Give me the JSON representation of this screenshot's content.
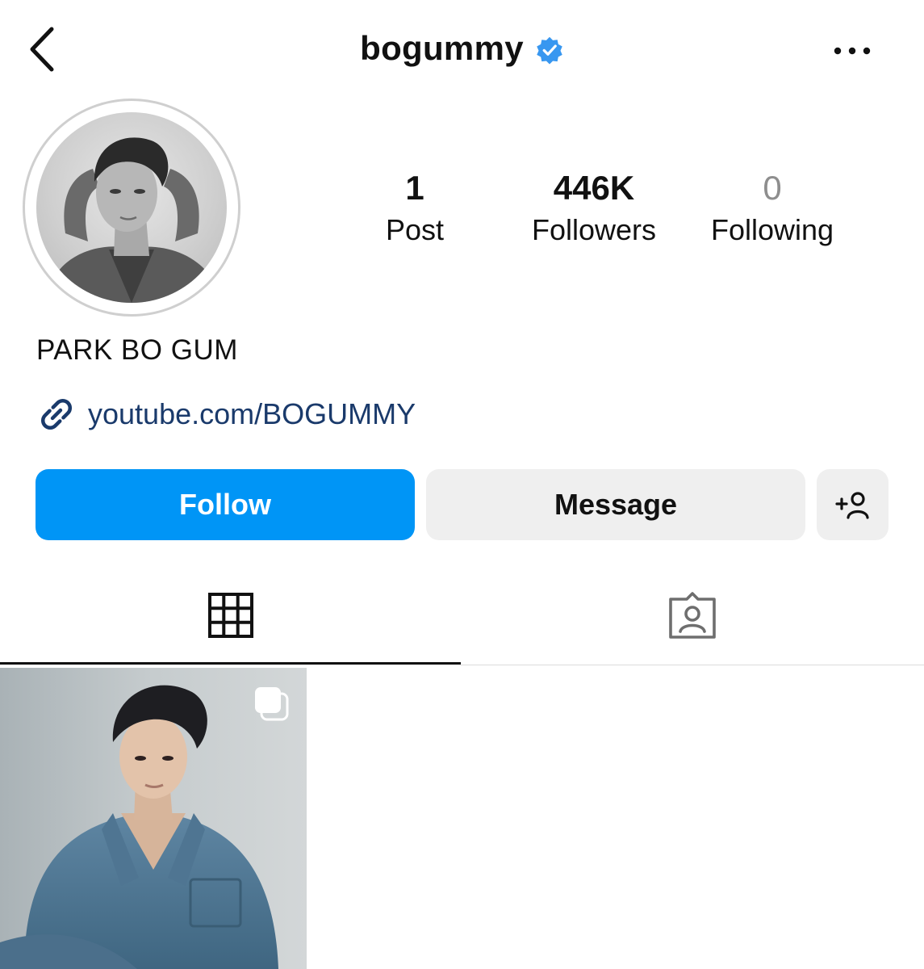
{
  "header": {
    "username": "bogummy",
    "back_icon": "chevron-left-icon",
    "verified_icon": "verified-badge-icon",
    "more_icon": "more-horizontal-icon"
  },
  "profile": {
    "full_name": "PARK BO GUM",
    "link_text": "youtube.com/BOGUMMY",
    "link_icon": "link-icon",
    "stats": {
      "posts": {
        "value": "1",
        "label": "Post"
      },
      "followers": {
        "value": "446K",
        "label": "Followers"
      },
      "following": {
        "value": "0",
        "label": "Following"
      }
    }
  },
  "actions": {
    "follow_label": "Follow",
    "message_label": "Message",
    "add_user_icon": "add-user-icon"
  },
  "tabs": [
    {
      "name": "posts",
      "icon": "grid-icon",
      "active": true
    },
    {
      "name": "tagged",
      "icon": "tagged-person-icon",
      "active": false
    }
  ],
  "posts": [
    {
      "type": "carousel",
      "icon": "multiple-images-icon"
    }
  ],
  "colors": {
    "accent": "#0095f6",
    "verified": "#3897f0",
    "link": "#1a3a6b",
    "secondary_button": "#efefef",
    "muted_text": "#8e8e8e"
  }
}
